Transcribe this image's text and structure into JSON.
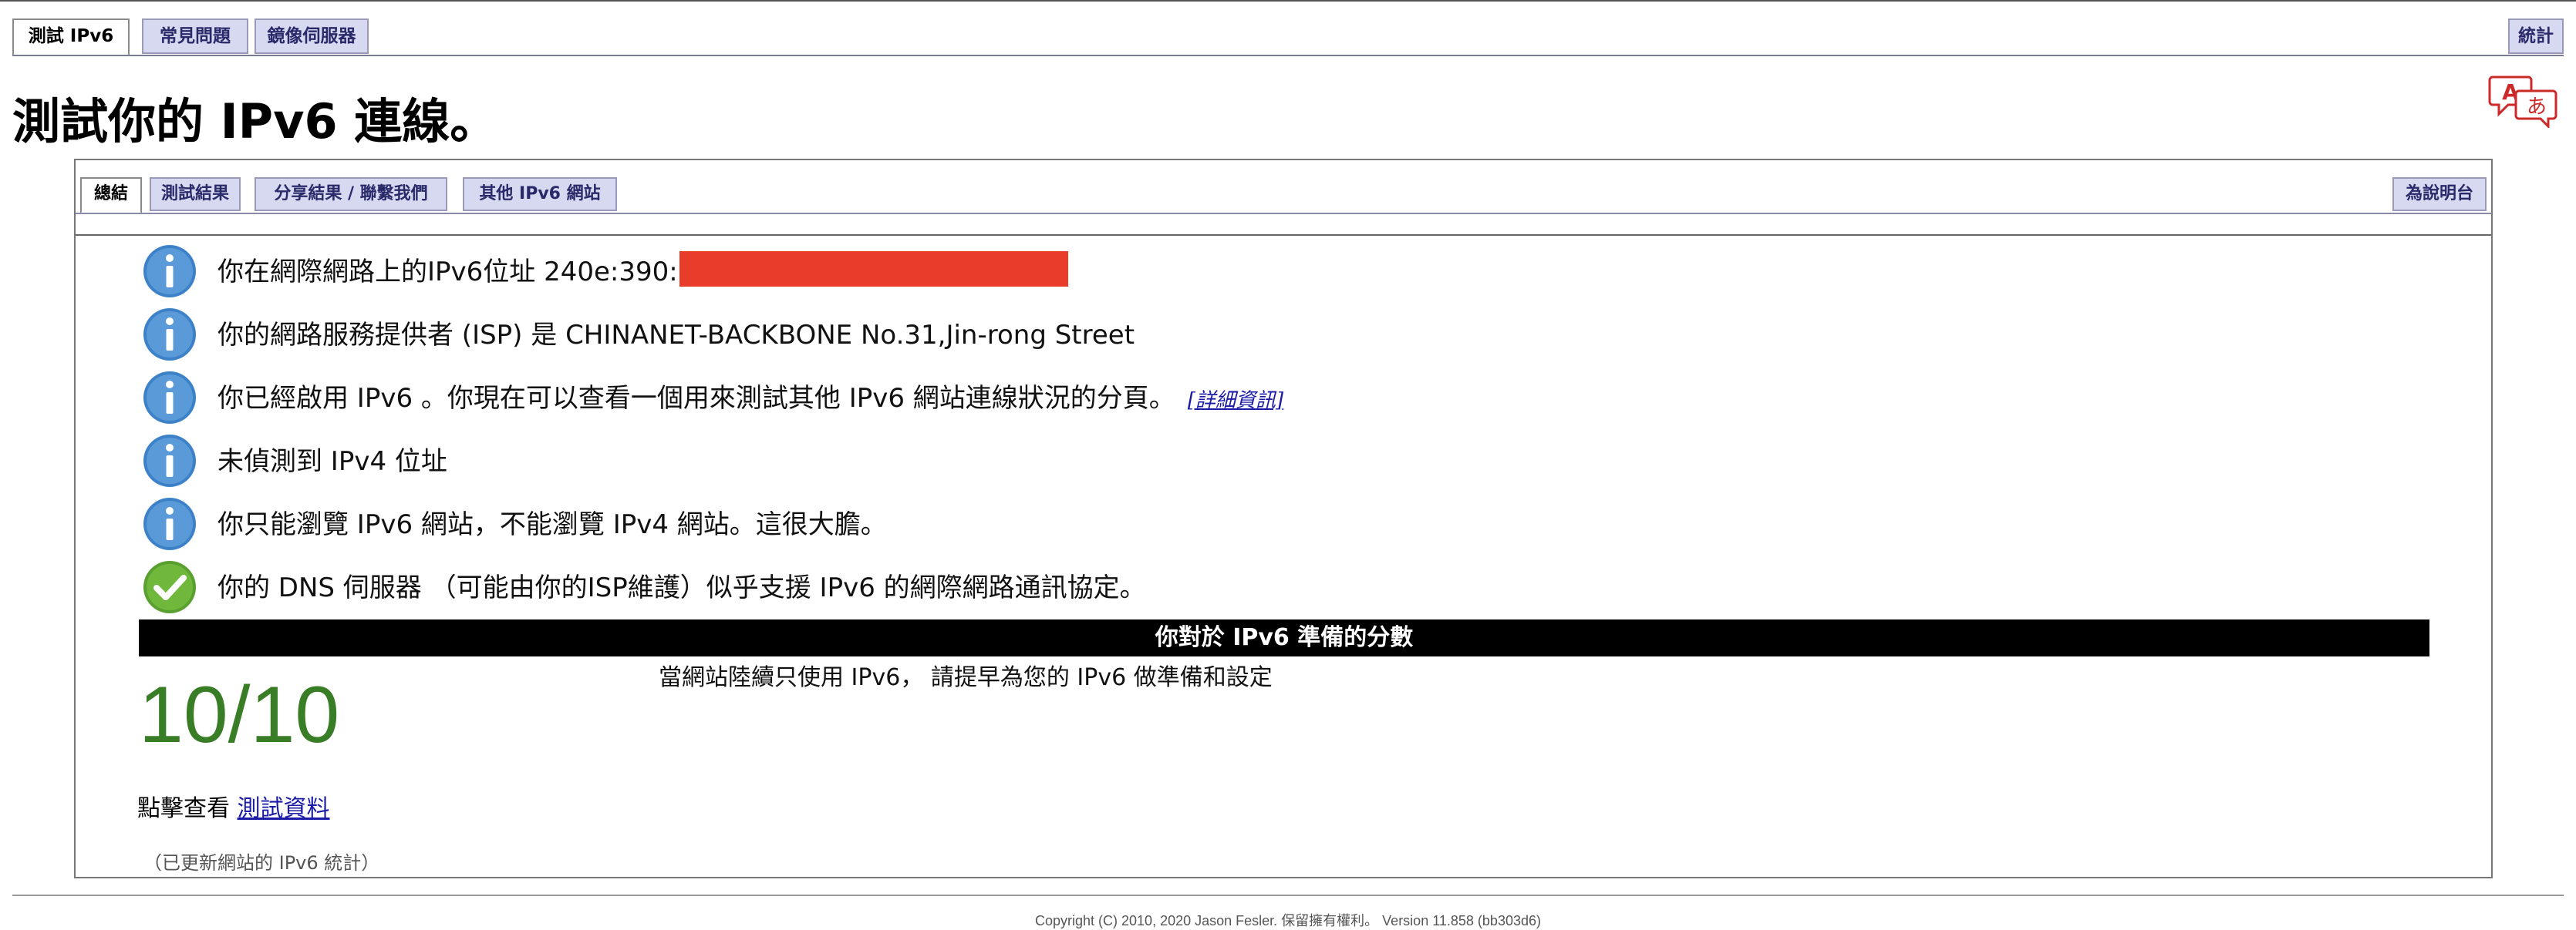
{
  "nav": {
    "tabs": [
      {
        "label": "測試 IPv6",
        "active": true
      },
      {
        "label": "常見問題",
        "active": false
      },
      {
        "label": "鏡像伺服器",
        "active": false
      }
    ],
    "stats_tab": "統計"
  },
  "language_icon": "language-translate-icon",
  "page_title": "測試你的 IPv6 連線。",
  "panel_tabs": [
    {
      "label": "總結",
      "active": true
    },
    {
      "label": "測試結果",
      "active": false
    },
    {
      "label": "分享結果 / 聯繫我們",
      "active": false
    },
    {
      "label": "其他 IPv6 網站",
      "active": false
    }
  ],
  "helpdesk_tab": "為說明台",
  "summary": [
    {
      "icon": "info-icon",
      "text": "你在網際網路上的IPv6位址 240e:390:",
      "redacted": true
    },
    {
      "icon": "info-icon",
      "text": "你的網路服務提供者 (ISP) 是 CHINANET-BACKBONE No.31,Jin-rong Street"
    },
    {
      "icon": "info-icon",
      "text": "你已經啟用 IPv6 。你現在可以查看一個用來測試其他 IPv6 網站連線狀況的分頁。",
      "link": "[詳細資訊]"
    },
    {
      "icon": "info-icon",
      "text": "未偵測到 IPv4 位址"
    },
    {
      "icon": "info-icon",
      "text": "你只能瀏覽 IPv6 網站，不能瀏覽 IPv4 網站。這很大膽。"
    },
    {
      "icon": "check-icon",
      "text": "你的 DNS 伺服器 （可能由你的ISP維護）似乎支援 IPv6 的網際網路通訊協定。"
    }
  ],
  "score": {
    "header": "你對於 IPv6 準備的分數",
    "value": "10/10",
    "description": "當網站陸續只使用 IPv6， 請提早為您的 IPv6 做準備和設定"
  },
  "more": {
    "prefix": "點擊查看 ",
    "link": "測試資料"
  },
  "updated_note": "（已更新網站的 IPv6 統計）",
  "footer": "Copyright (C) 2010, 2020 Jason Fesler. 保留擁有權利。 Version 11.858 (bb303d6)",
  "colors": {
    "score_green": "#3a7d27",
    "info_blue": "#3d82c8",
    "check_green": "#6fb83c",
    "redaction": "#ea3c2b",
    "tab_bg": "#d7d9f0",
    "link": "#1a1aa6"
  }
}
